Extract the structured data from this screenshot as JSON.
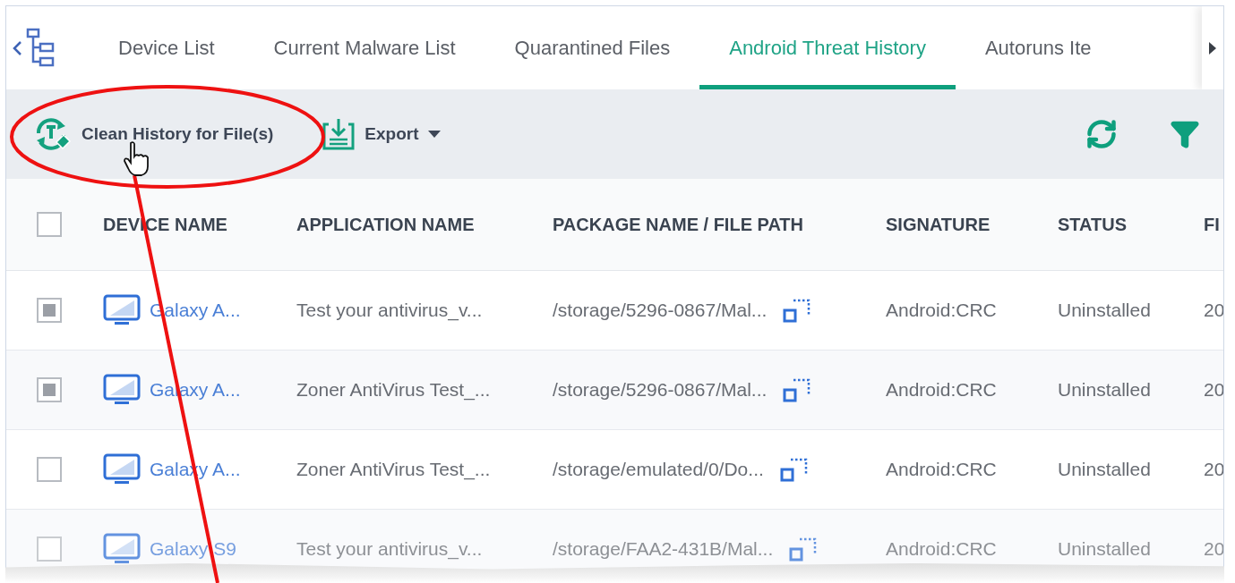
{
  "tabs": [
    {
      "label": "Device List",
      "selected": false
    },
    {
      "label": "Current Malware List",
      "selected": false
    },
    {
      "label": "Quarantined Files",
      "selected": false
    },
    {
      "label": "Android Threat History",
      "selected": true
    },
    {
      "label": "Autoruns Ite",
      "selected": false
    }
  ],
  "toolbar": {
    "clean_button": "Clean History for File(s)",
    "export_button": "Export"
  },
  "table": {
    "select_all": {
      "checked": false
    },
    "columns": [
      "DEVICE NAME",
      "APPLICATION NAME",
      "PACKAGE NAME / FILE PATH",
      "SIGNATURE",
      "STATUS",
      "FI"
    ],
    "rows": [
      {
        "checked": true,
        "device": "Galaxy A...",
        "application": "Test your antivirus_v...",
        "path": "/storage/5296-0867/Mal...",
        "signature": "Android:CRC",
        "status": "Uninstalled",
        "column_6": "20"
      },
      {
        "checked": true,
        "device": "Galaxy A...",
        "application": "Zoner AntiVirus Test_...",
        "path": "/storage/5296-0867/Mal...",
        "signature": "Android:CRC",
        "status": "Uninstalled",
        "column_6": "20"
      },
      {
        "checked": false,
        "device": "Galaxy A...",
        "application": "Zoner AntiVirus Test_...",
        "path": "/storage/emulated/0/Do...",
        "signature": "Android:CRC",
        "status": "Uninstalled",
        "column_6": "20"
      },
      {
        "checked": false,
        "device": "Galaxy S9",
        "application": "Test your antivirus_v...",
        "path": "/storage/FAA2-431B/Mal...",
        "signature": "Android:CRC",
        "status": "Uninstalled",
        "column_6": "20"
      }
    ]
  }
}
